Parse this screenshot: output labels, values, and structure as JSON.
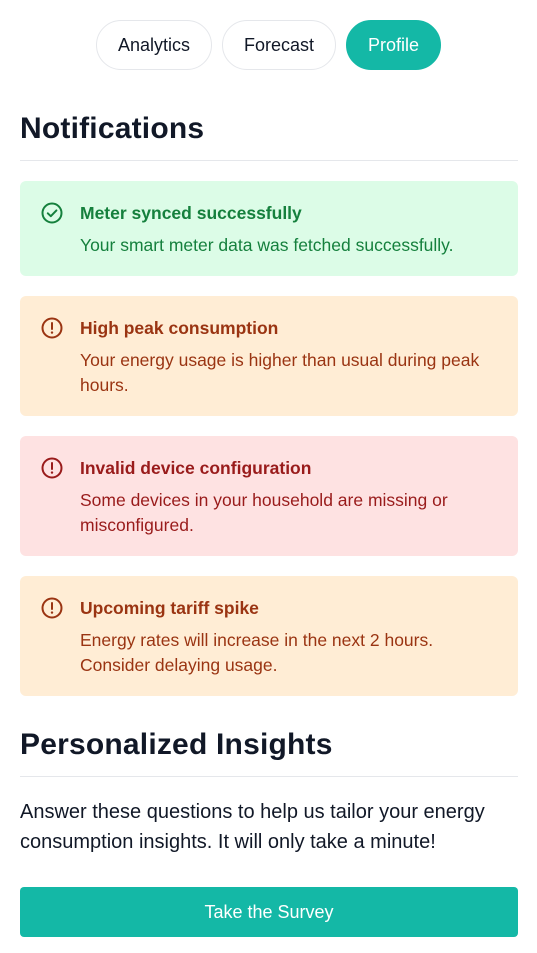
{
  "nav": {
    "tabs": [
      {
        "label": "Analytics",
        "active": false
      },
      {
        "label": "Forecast",
        "active": false
      },
      {
        "label": "Profile",
        "active": true
      }
    ]
  },
  "notifications": {
    "heading": "Notifications",
    "items": [
      {
        "type": "success",
        "icon": "check-circle-icon",
        "title": "Meter synced successfully",
        "message": "Your smart meter data was fetched successfully."
      },
      {
        "type": "warning",
        "icon": "alert-circle-icon",
        "title": "High peak consumption",
        "message": "Your energy usage is higher than usual during peak hours."
      },
      {
        "type": "error",
        "icon": "alert-circle-icon",
        "title": "Invalid device configuration",
        "message": "Some devices in your household are missing or misconfigured."
      },
      {
        "type": "warning",
        "icon": "alert-circle-icon",
        "title": "Upcoming tariff spike",
        "message": "Energy rates will increase in the next 2 hours. Consider delaying usage."
      }
    ]
  },
  "insights": {
    "heading": "Personalized Insights",
    "description": "Answer these questions to help us tailor your energy consumption insights. It will only take a minute!",
    "button_label": "Take the Survey"
  },
  "colors": {
    "accent": "#14b8a6",
    "success_bg": "#dcfce7",
    "success_text": "#15803d",
    "warning_bg": "#ffedd5",
    "warning_text": "#9a3412",
    "error_bg": "#fee2e2",
    "error_text": "#991b1b"
  }
}
